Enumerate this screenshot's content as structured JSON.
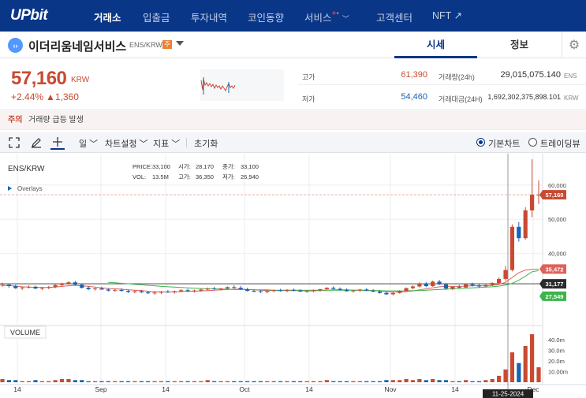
{
  "nav": {
    "logo": "UPbit",
    "items": [
      {
        "label": "거래소",
        "active": true
      },
      {
        "label": "입출금"
      },
      {
        "label": "투자내역"
      },
      {
        "label": "코인동향"
      },
      {
        "label": "서비스"
      },
      {
        "label": "고객센터"
      },
      {
        "label": "NFT ↗"
      }
    ],
    "service_badge": "+",
    "service_dot": "•"
  },
  "coin": {
    "icon_text": "‹›",
    "name": "이더리움네임서비스",
    "pair": "ENS/KRW",
    "warning": "주",
    "tabs": [
      "시세",
      "정보"
    ]
  },
  "ticker": {
    "price": "57,160",
    "currency": "KRW",
    "change_pct": "+2.44%",
    "change_abs": "▲1,360",
    "high_label": "고가",
    "high": "61,390",
    "low_label": "저가",
    "low": "54,460",
    "vol_label": "거래량(24h)",
    "vol": "29,015,075.140",
    "vol_unit": "ENS",
    "amt_label": "거래대금(24H)",
    "amt": "1,692,302,375,898.101",
    "amt_unit": "KRW"
  },
  "notice": {
    "label": "주의",
    "text": "거래량 급등 발생"
  },
  "toolbar": {
    "interval": "일",
    "chart_settings": "차트설정",
    "indicators": "지표",
    "reset": "초기화",
    "basic_chart": "기본차트",
    "tradingview": "트레이딩뷰"
  },
  "chart_data": {
    "type": "candlestick",
    "symbol": "ENS/KRW",
    "overlays_label": "Overlays",
    "info": {
      "price_label": "PRICE:",
      "price": "33,100",
      "open_label": "시가:",
      "open": "28,170",
      "close_label": "종가:",
      "close": "33,100",
      "vol_label": "VOL:",
      "vol": "13.5M",
      "high_label": "고가:",
      "high": "36,350",
      "low_label": "저가:",
      "low": "26,940"
    },
    "y_ticks": [
      "60,000",
      "50,000",
      "40,000"
    ],
    "y_range": [
      19000,
      68000
    ],
    "price_tags": [
      {
        "value": 57160,
        "label": "57,160",
        "color": "#c84a31"
      },
      {
        "value": 35472,
        "label": "35,472",
        "color": "#e0605a"
      },
      {
        "value": 31177,
        "label": "31,177",
        "color": "#2b2b2b"
      },
      {
        "value": 27549,
        "label": "27,549",
        "color": "#3cb44b"
      }
    ],
    "x_labels": [
      "14",
      "Sep",
      "14",
      "Oct",
      "14",
      "Nov",
      "14",
      "Dec"
    ],
    "crosshair_date": "11-25-2024",
    "volume_label": "VOLUME",
    "volume_ticks": [
      "40.0m",
      "30.0m",
      "20.0m",
      "10.00m"
    ],
    "volume_range": [
      0,
      48
    ],
    "candles": [
      [
        30800,
        31500,
        30300,
        30900
      ],
      [
        30900,
        31200,
        30000,
        30500
      ],
      [
        30500,
        30900,
        29700,
        29900
      ],
      [
        29900,
        30300,
        29400,
        30100
      ],
      [
        30100,
        30700,
        29800,
        30300
      ],
      [
        30300,
        30600,
        29600,
        29800
      ],
      [
        29800,
        30200,
        29300,
        30000
      ],
      [
        30000,
        30500,
        29600,
        30200
      ],
      [
        30200,
        31000,
        29900,
        30800
      ],
      [
        30800,
        31500,
        30500,
        31300
      ],
      [
        31300,
        31900,
        30900,
        31600
      ],
      [
        31600,
        32000,
        30700,
        30900
      ],
      [
        30900,
        31200,
        29800,
        30000
      ],
      [
        30000,
        30400,
        29300,
        29600
      ],
      [
        29600,
        30100,
        29200,
        29800
      ],
      [
        29800,
        30300,
        29400,
        29500
      ],
      [
        29500,
        29900,
        28900,
        29200
      ],
      [
        29200,
        29700,
        28800,
        29400
      ],
      [
        29400,
        29800,
        28900,
        29100
      ],
      [
        29100,
        29500,
        28500,
        28800
      ],
      [
        28800,
        29300,
        28400,
        29000
      ],
      [
        29000,
        29400,
        28500,
        28700
      ],
      [
        28700,
        29100,
        28200,
        28400
      ],
      [
        28400,
        28900,
        28000,
        28600
      ],
      [
        28600,
        29100,
        28200,
        28900
      ],
      [
        28900,
        29300,
        28500,
        28700
      ],
      [
        28700,
        29200,
        28300,
        29000
      ],
      [
        29000,
        29600,
        28700,
        29300
      ],
      [
        29300,
        29700,
        28800,
        29000
      ],
      [
        29000,
        29500,
        28600,
        29200
      ],
      [
        29200,
        29700,
        28900,
        29500
      ],
      [
        29500,
        30100,
        29200,
        29800
      ],
      [
        29800,
        30300,
        29400,
        29600
      ],
      [
        29600,
        30000,
        29200,
        29800
      ],
      [
        29800,
        30400,
        29500,
        30200
      ],
      [
        30200,
        30700,
        29800,
        30000
      ],
      [
        30000,
        30500,
        29400,
        29600
      ],
      [
        29600,
        30000,
        28900,
        29100
      ],
      [
        29100,
        29500,
        28700,
        29000
      ],
      [
        29000,
        29400,
        28500,
        28800
      ],
      [
        28800,
        29300,
        28400,
        29100
      ],
      [
        29100,
        29500,
        28700,
        29300
      ],
      [
        29300,
        29700,
        28900,
        29100
      ],
      [
        29100,
        29600,
        28700,
        29400
      ],
      [
        29400,
        29800,
        29000,
        29200
      ],
      [
        29200,
        29600,
        28800,
        28900
      ],
      [
        28900,
        29300,
        28500,
        29100
      ],
      [
        29100,
        29500,
        28700,
        29300
      ],
      [
        29300,
        29700,
        28900,
        29600
      ],
      [
        29600,
        30200,
        29300,
        30000
      ],
      [
        30000,
        30400,
        29500,
        29700
      ],
      [
        29700,
        30100,
        29200,
        29400
      ],
      [
        29400,
        29800,
        28900,
        29000
      ],
      [
        29000,
        29400,
        28600,
        29200
      ],
      [
        29200,
        29700,
        28800,
        29500
      ],
      [
        29500,
        29900,
        29000,
        29200
      ],
      [
        29200,
        29600,
        28700,
        28900
      ],
      [
        28900,
        29300,
        28300,
        28500
      ],
      [
        28500,
        28900,
        27900,
        28100
      ],
      [
        28100,
        28700,
        27800,
        28500
      ],
      [
        28500,
        29300,
        28300,
        29100
      ],
      [
        29100,
        30100,
        28900,
        29900
      ],
      [
        29900,
        30700,
        29600,
        30400
      ],
      [
        30400,
        31600,
        30100,
        31200
      ],
      [
        31200,
        31700,
        30200,
        30500
      ],
      [
        30500,
        32100,
        30300,
        31800
      ],
      [
        31800,
        32300,
        30800,
        31000
      ],
      [
        31000,
        31400,
        29400,
        29800
      ],
      [
        29800,
        30500,
        29300,
        30300
      ],
      [
        30300,
        30800,
        29800,
        30100
      ],
      [
        30100,
        31200,
        29900,
        31000
      ],
      [
        31000,
        31500,
        30400,
        30700
      ],
      [
        30700,
        31100,
        30000,
        30400
      ],
      [
        30400,
        31000,
        30100,
        30800
      ],
      [
        30800,
        31600,
        30500,
        31400
      ],
      [
        31400,
        33000,
        31100,
        32600
      ],
      [
        32600,
        36400,
        32000,
        35200
      ],
      [
        35200,
        48500,
        34800,
        47800
      ],
      [
        47800,
        49200,
        43500,
        44500
      ],
      [
        44500,
        53500,
        44000,
        52600
      ],
      [
        52600,
        67500,
        50600,
        57160
      ],
      [
        57160,
        61400,
        54460,
        57160
      ]
    ],
    "volumes": [
      3,
      2,
      2,
      1,
      1,
      2,
      1,
      1,
      2,
      3,
      3,
      2,
      2,
      1,
      1,
      1,
      1,
      1,
      1,
      1,
      1,
      1,
      1,
      1,
      1,
      1,
      1,
      1,
      1,
      1,
      1,
      2,
      1,
      1,
      1,
      1,
      1,
      1,
      1,
      1,
      1,
      1,
      1,
      1,
      1,
      1,
      1,
      1,
      1,
      2,
      1,
      1,
      1,
      1,
      1,
      1,
      1,
      1,
      2,
      2,
      2,
      3,
      2,
      3,
      2,
      3,
      2,
      2,
      1,
      1,
      2,
      1,
      1,
      2,
      3,
      6,
      12,
      28,
      18,
      34,
      45,
      14
    ],
    "ma_red": [
      30700,
      30650,
      30500,
      30300,
      30200,
      30150,
      30100,
      30100,
      30200,
      30400,
      30600,
      30700,
      30600,
      30400,
      30200,
      30000,
      29800,
      29700,
      29600,
      29400,
      29300,
      29200,
      29000,
      28900,
      28800,
      28800,
      28800,
      28900,
      29000,
      29000,
      29100,
      29200,
      29300,
      29400,
      29500,
      29600,
      29600,
      29500,
      29400,
      29300,
      29200,
      29200,
      29200,
      29200,
      29200,
      29200,
      29100,
      29100,
      29200,
      29300,
      29400,
      29400,
      29400,
      29300,
      29300,
      29300,
      29200,
      29100,
      28900,
      28800,
      28800,
      28900,
      29100,
      29400,
      29700,
      30000,
      30300,
      30400,
      30400,
      30400,
      30500,
      30600,
      30600,
      30600,
      30700,
      31000,
      31600,
      33000,
      34400,
      35200,
      35400,
      35472
    ],
    "ma_green": [
      null,
      null,
      null,
      null,
      null,
      null,
      null,
      null,
      null,
      null,
      null,
      null,
      null,
      null,
      null,
      null,
      31600,
      31500,
      31300,
      31200,
      31000,
      30900,
      30700,
      30600,
      30400,
      30300,
      30200,
      30100,
      30000,
      29900,
      29800,
      29700,
      29700,
      29600,
      29600,
      29500,
      29500,
      29500,
      29400,
      29400,
      29400,
      29300,
      29300,
      29300,
      29300,
      29300,
      29300,
      29300,
      29300,
      29300,
      29300,
      29300,
      29300,
      29300,
      29300,
      29200,
      29200,
      29200,
      29100,
      29100,
      29100,
      29100,
      29200,
      29200,
      29300,
      29400,
      29500,
      29600,
      29700,
      29800,
      29900,
      30000,
      30100,
      30200,
      30300,
      30500,
      30800,
      31300,
      32200,
      33400,
      34700,
      27549
    ]
  }
}
